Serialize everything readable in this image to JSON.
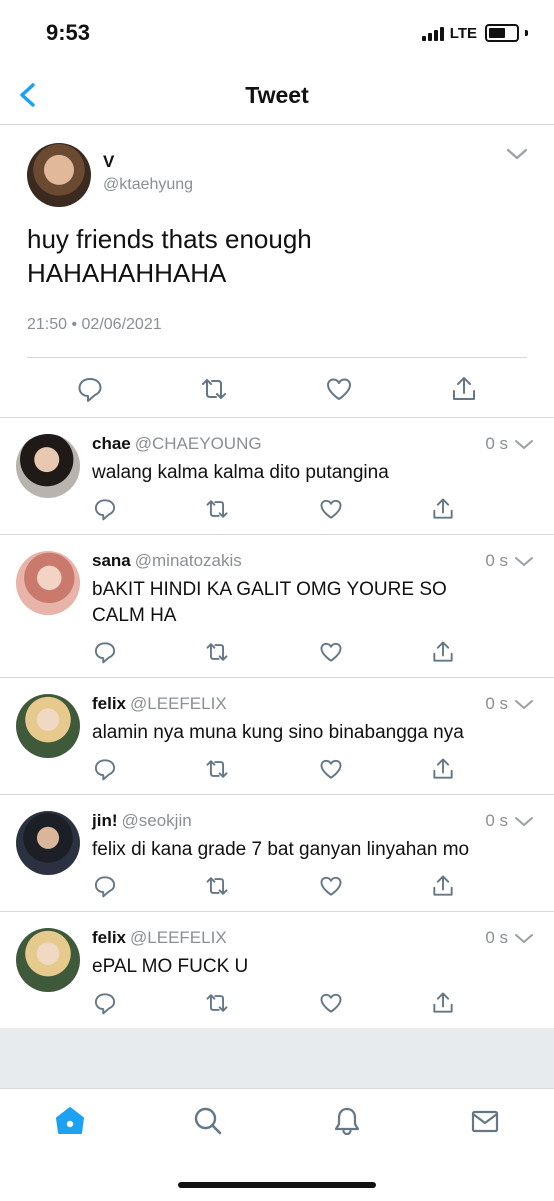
{
  "status_bar": {
    "time": "9:53",
    "network": "LTE"
  },
  "header": {
    "title": "Tweet"
  },
  "main_tweet": {
    "name": "V",
    "handle": "@ktaehyung",
    "text_line1": "huy friends thats enough",
    "text_line2": "HAHAHAHHAHA",
    "timestamp": "21:50 • 02/06/2021"
  },
  "replies": [
    {
      "name": "chae",
      "handle": "@CHAEYOUNG",
      "time": "0 s",
      "text": "walang kalma kalma dito putangina"
    },
    {
      "name": "sana",
      "handle": "@minatozakis",
      "time": "0 s",
      "text": "bAKIT HINDI KA GALIT OMG YOURE SO CALM HA"
    },
    {
      "name": "felix",
      "handle": "@LEEFELIX",
      "time": "0 s",
      "text": "alamin nya muna kung sino binabangga nya"
    },
    {
      "name": "jin!",
      "handle": "@seokjin",
      "time": "0 s",
      "text": "felix di kana grade 7 bat ganyan linyahan mo"
    },
    {
      "name": "felix",
      "handle": "@LEEFELIX",
      "time": "0 s",
      "text": "ePAL MO FUCK U"
    }
  ],
  "icons": {
    "back": "chevron-left-icon",
    "more": "chevron-down-icon",
    "reply": "reply-icon",
    "retweet": "retweet-icon",
    "like": "heart-icon",
    "share": "share-icon",
    "tabs": [
      "home-icon",
      "search-icon",
      "bell-icon",
      "mail-icon"
    ]
  },
  "colors": {
    "accent": "#1da1f2",
    "muted": "#8a8f94",
    "divider": "#d6d9dc",
    "background_gray": "#e8ebee"
  }
}
